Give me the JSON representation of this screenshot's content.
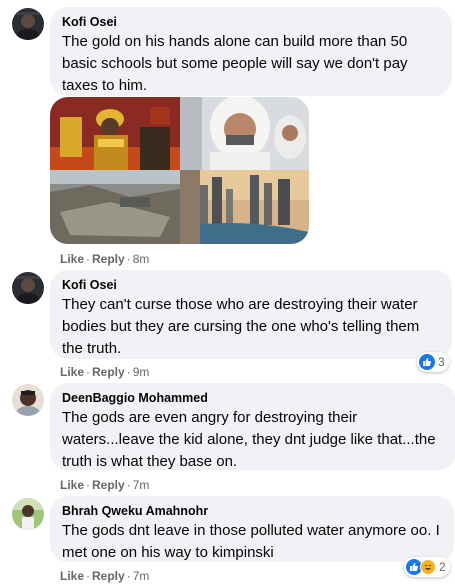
{
  "comments": [
    {
      "author": "Kofi Osei",
      "text": "The gold on his hands alone can build more than 50 basic schools but some people will say we don't pay taxes to him.",
      "like": "Like",
      "reply": "Reply",
      "time": "8m",
      "has_photo": true,
      "photo_panels": [
        "chief-in-gold-regalia",
        "sheikh-in-white",
        "polluted-mining-land",
        "dubai-skyline"
      ]
    },
    {
      "author": "Kofi Osei",
      "text": "They can't curse those who are destroying their water bodies but they are cursing the one who's telling them the truth.",
      "like": "Like",
      "reply": "Reply",
      "time": "9m",
      "reaction_count": "3",
      "reaction_icons": [
        "like-icon"
      ]
    },
    {
      "author": "DeenBaggio Mohammed",
      "text": "The gods are even angry for destroying their waters...leave the kid alone, they dnt judge like that...the truth is what they base on.",
      "like": "Like",
      "reply": "Reply",
      "time": "7m"
    },
    {
      "author": "Bhrah Qweku Amahnohr",
      "text": "The gods dnt leave in those polluted water anymore oo. I met one on his way to kimpinski",
      "like": "Like",
      "reply": "Reply",
      "time": "7m",
      "reaction_count": "2",
      "reaction_icons": [
        "like-icon",
        "haha-icon"
      ]
    }
  ],
  "colors": {
    "bubble": "#f0f2f5",
    "secondary_text": "#65676b",
    "like_blue": "#1877f2",
    "haha_yellow": "#f7b125"
  }
}
